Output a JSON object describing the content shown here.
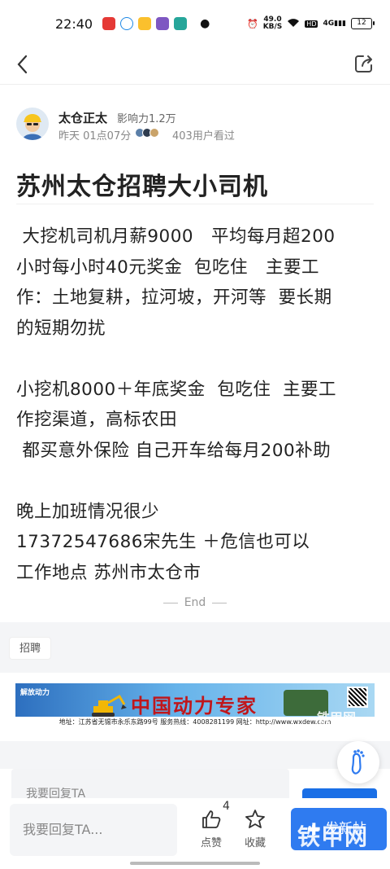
{
  "status_bar": {
    "time": "22:40",
    "net_speed_value": "49.0",
    "net_speed_unit": "KB/S",
    "network": "4G",
    "battery": "12"
  },
  "author": {
    "name": "太仓正太",
    "influence": "影响力1.2万",
    "time": "昨天 01点07分",
    "viewers": "403用户看过"
  },
  "post": {
    "title": "苏州太仓招聘大小司机",
    "body_lines": [
      " 大挖机司机月薪9000   平均每月超200",
      "小时每小时40元奖金  包吃住   主要工",
      "作：土地复耕，拉河坡，开河等  要长期",
      "的短期勿扰",
      "",
      "小挖机8000＋年底奖金  包吃住  主要工",
      "作挖渠道，高标农田",
      " 都买意外保险 自己开车给每月200补助",
      "",
      "晚上加班情况很少",
      "17372547686宋先生 ＋危信也可以",
      "工作地点 苏州市太仓市"
    ],
    "end_label": "End"
  },
  "tag": "招聘",
  "ad": {
    "brand": "解放动力",
    "title": "中国动力专家",
    "footer": "地址：江苏省无锡市永乐东路99号   服务热线：4008281199   网址：http://www.wxdew.com",
    "watermark": "铁甲网"
  },
  "faded_card": {
    "text": "我要回复TA"
  },
  "bottom_bar": {
    "reply_placeholder": "我要回复TA...",
    "like_count": "4",
    "like_label": "点赞",
    "fav_label": "收藏",
    "post_label": "发新帖"
  },
  "watermark": "铁甲网",
  "colors": {
    "accent": "#2f7bf0",
    "ad_title": "#c0161b"
  }
}
